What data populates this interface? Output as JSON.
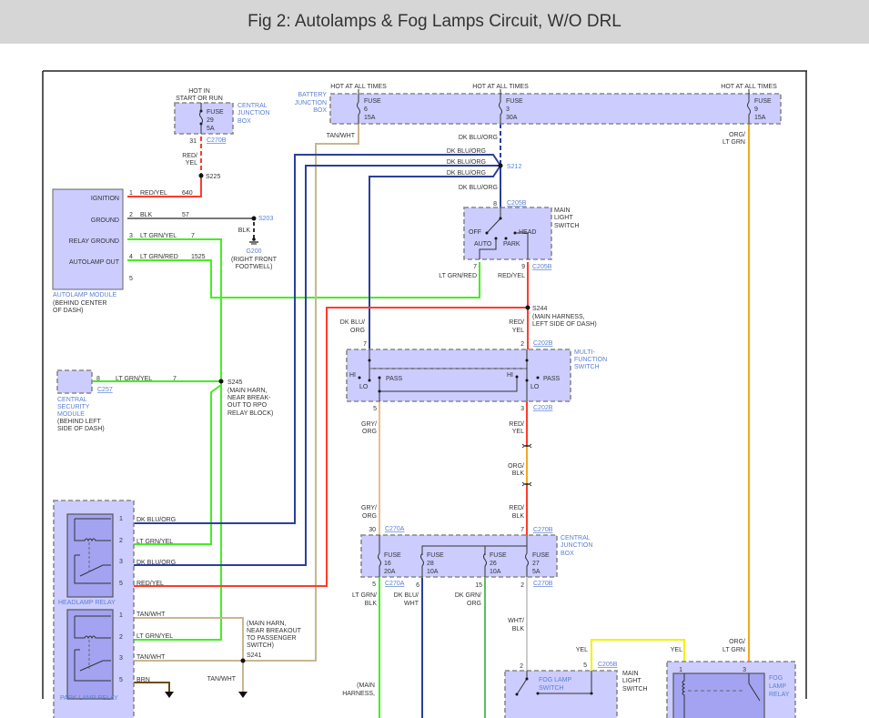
{
  "title": "Fig 2: Autolamps & Fog Lamps Circuit, W/O DRL",
  "colors": {
    "red_yel": "#ff3b2b",
    "blk": "#777777",
    "lt_grn": "#44ee22",
    "dk_blu_org": "#2b3f9b",
    "tan_wht": "#c8b78e",
    "org_lt_grn": "#f5a623",
    "yel": "#f2f200",
    "brn": "#6b4c0c",
    "wht_blk": "#cccccc",
    "dk_grn_org": "#5cbf5c",
    "box_fill": "#ccccff"
  },
  "cjb_top": {
    "hot": [
      "HOT IN",
      "START OR RUN"
    ],
    "fuse": [
      "FUSE",
      "29",
      "5A"
    ],
    "name": [
      "CENTRAL",
      "JUNCTION",
      "BOX"
    ],
    "pin": "31",
    "connector": "C270B",
    "wire": [
      "RED/",
      "YEL"
    ],
    "splice": "S225"
  },
  "autolamp_module": {
    "pins": [
      {
        "label": "IGNITION",
        "num": "1",
        "wire": "RED/YEL",
        "circuit": "640"
      },
      {
        "label": "GROUND",
        "num": "2",
        "wire": "BLK",
        "circuit": "57"
      },
      {
        "label": "RELAY GROUND",
        "num": "3",
        "wire": "LT GRN/YEL",
        "circuit": "7"
      },
      {
        "label": "AUTOLAMP OUT",
        "num": "4",
        "wire": "LT GRN/RED",
        "circuit": "1525"
      },
      {
        "num": "5"
      }
    ],
    "name": "AUTOLAMP MODULE",
    "location": [
      "(BEHIND CENTER",
      "OF DASH)"
    ]
  },
  "ground": {
    "splice": "S203",
    "wire": "BLK",
    "id": "G200",
    "location": [
      "(RIGHT FRONT",
      "FOOTWELL)"
    ]
  },
  "battery_jb": {
    "name": [
      "BATTERY",
      "JUNCTION",
      "BOX"
    ],
    "fuses": [
      {
        "hot": "HOT AT ALL TIMES",
        "label": "FUSE",
        "num": "6",
        "amps": "15A"
      },
      {
        "hot": "HOT AT ALL TIMES",
        "label": "FUSE",
        "num": "3",
        "amps": "30A"
      },
      {
        "hot": "HOT AT ALL TIMES",
        "label": "FUSE",
        "num": "9",
        "amps": "15A"
      }
    ]
  },
  "wires_top": {
    "tan_wht": "TAN/WHT",
    "dk_blu_org": [
      "DK BLU/ORG",
      "DK BLU/ORG",
      "DK BLU/ORG",
      "DK BLU/ORG",
      "DK BLU/ORG"
    ],
    "splice": "S212",
    "org_lt_grn": [
      "ORG/",
      "LT GRN"
    ]
  },
  "main_light_switch": {
    "pin_in": "8",
    "connector_in": "C205B",
    "name": [
      "MAIN",
      "LIGHT",
      "SWITCH"
    ],
    "positions": [
      "OFF",
      "AUTO",
      "PARK",
      "HEAD"
    ],
    "pin_out_auto": "7",
    "pin_out_head": "9",
    "connector_out": "C205B",
    "wire_auto": "LT GRN/RED",
    "wire_head": "RED/YEL"
  },
  "s244": {
    "splice": "S244",
    "location": [
      "(MAIN HARNESS,",
      "LEFT SIDE OF DASH)"
    ],
    "wire_left": [
      "DK BLU/",
      "ORG"
    ],
    "wire_right": [
      "RED/",
      "YEL"
    ]
  },
  "security_module": {
    "pin": "8",
    "wire": "LT GRN/YEL",
    "circuit": "7",
    "connector": "C257",
    "name": [
      "CENTRAL",
      "SECURITY",
      "MODULE"
    ],
    "location": [
      "(BEHIND LEFT",
      "SIDE OF DASH)"
    ]
  },
  "s245": {
    "splice": "S245",
    "location": [
      "(MAIN HARN,",
      "NEAR BREAK-",
      "OUT TO RPO",
      "RELAY BLOCK)"
    ]
  },
  "multifunction_switch": {
    "name": [
      "MULTI-",
      "FUNCTION",
      "SWITCH"
    ],
    "pin_in_left": "7",
    "pin_in_right": "2",
    "connector_in": "C202B",
    "pin_out_left": "5",
    "pin_out_right": "3",
    "connector_out": "C202B",
    "positions_left": [
      "HI",
      "LO",
      "PASS"
    ],
    "positions_right": [
      "HI",
      "LO",
      "PASS"
    ]
  },
  "mid_wires": {
    "gry_org_1": [
      "GRY/",
      "ORG"
    ],
    "gry_org_2": [
      "GRY/",
      "ORG"
    ],
    "red_yel": [
      "RED/",
      "YEL"
    ],
    "org_blk": [
      "ORG/",
      "BLK"
    ],
    "red_blk": [
      "RED/",
      "BLK"
    ]
  },
  "cjb_lower": {
    "name": [
      "CENTRAL",
      "JUNCTION",
      "BOX"
    ],
    "pin_30": "30",
    "connector_a": "C270A",
    "pin_7": "7",
    "connector_b": "C270B",
    "fuses": [
      {
        "label": "FUSE",
        "num": "16",
        "amps": "20A"
      },
      {
        "label": "FUSE",
        "num": "28",
        "amps": "10A"
      },
      {
        "label": "FUSE",
        "num": "26",
        "amps": "10A"
      },
      {
        "label": "FUSE",
        "num": "27",
        "amps": "5A"
      }
    ],
    "out_pins": [
      "5",
      "6",
      "15",
      "2"
    ],
    "out_connector_a": "C270A",
    "out_connector_b": "C270B",
    "out_wires": [
      [
        "LT GRN/",
        "BLK"
      ],
      [
        "DK BLU/",
        "WHT"
      ],
      [
        "DK GRN/",
        "ORG"
      ],
      [
        "WHT/",
        "BLK"
      ]
    ],
    "harness_note": [
      "(MAIN",
      "HARNESS,"
    ]
  },
  "headlamp_relay": {
    "name": "HEADLAMP RELAY",
    "pins": [
      {
        "num": "1",
        "wire": "DK BLU/ORG"
      },
      {
        "num": "2",
        "wire": "LT GRN/YEL"
      },
      {
        "num": "3",
        "wire": "DK BLU/ORG"
      },
      {
        "num": "5",
        "wire": "RED/YEL"
      }
    ]
  },
  "park_lamp_relay": {
    "name": "PARK LAMP RELAY",
    "pins": [
      {
        "num": "1",
        "wire": "TAN/WHT"
      },
      {
        "num": "2",
        "wire": "LT GRN/YEL"
      },
      {
        "num": "3",
        "wire": "TAN/WHT"
      },
      {
        "num": "5",
        "wire": "BRN"
      }
    ]
  },
  "s241": {
    "splice": "S241",
    "location": [
      "(MAIN HARN,",
      "NEAR BREAKOUT",
      "TO PASSENGER",
      "SWITCH)"
    ],
    "wire_down": "TAN/WHT"
  },
  "fog": {
    "wire_yel_1": "YEL",
    "wire_yel_2": "YEL",
    "switch_pin_in": "2",
    "switch_pin_yel": "5",
    "switch_connector": "C205B",
    "switch_name": [
      "FOG LAMP",
      "SWITCH"
    ],
    "main_switch_name": [
      "MAIN",
      "LIGHT",
      "SWITCH"
    ],
    "relay_pin_1": "1",
    "relay_pin_3": "3",
    "relay_name": [
      "FOG",
      "LAMP",
      "RELAY"
    ],
    "org_lt_grn": [
      "ORG/",
      "LT GRN"
    ]
  }
}
